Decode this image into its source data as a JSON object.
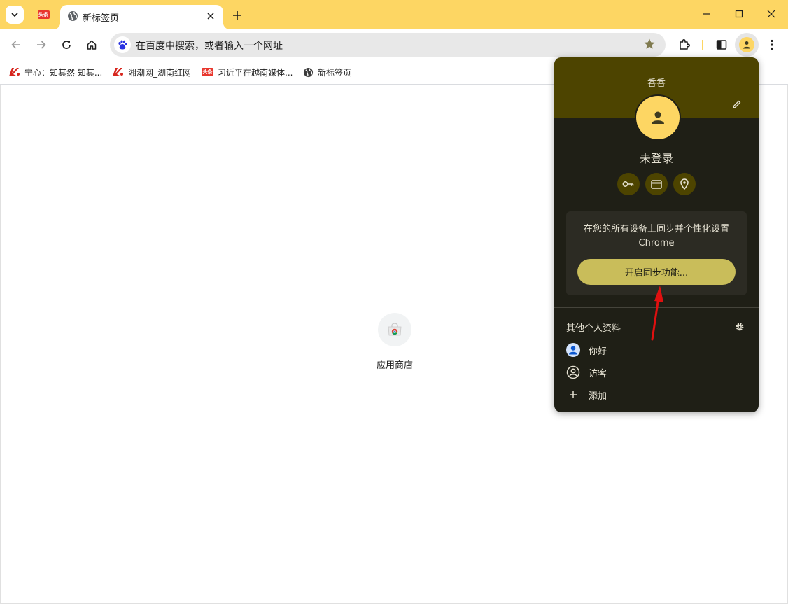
{
  "tabs": {
    "pinned_favicon_text": "头条",
    "active_title": "新标签页"
  },
  "omnibox": {
    "placeholder": "在百度中搜索，或者输入一个网址"
  },
  "bookmarks": [
    {
      "label": "宁心：知其然 知其..."
    },
    {
      "label": "湘潮网_湖南红网"
    },
    {
      "label": "习近平在越南媒体..."
    },
    {
      "label": "新标签页"
    }
  ],
  "bookmark_favicon_text": "头条",
  "content": {
    "shortcut_label": "应用商店"
  },
  "profile_popup": {
    "name": "香香",
    "status": "未登录",
    "sync_line1": "在您的所有设备上同步并个性化设置",
    "sync_line2": "Chrome",
    "sync_button": "开启同步功能...",
    "other_profiles_title": "其他个人资料",
    "profiles": [
      {
        "label": "你好"
      },
      {
        "label": "访客"
      },
      {
        "label": "添加"
      }
    ]
  },
  "colors": {
    "theme_yellow": "#fdd663",
    "popup_bg": "#1f1f16",
    "popup_header": "#4d4400",
    "sync_button": "#c9bd5a",
    "annotation_arrow": "#e01010"
  }
}
